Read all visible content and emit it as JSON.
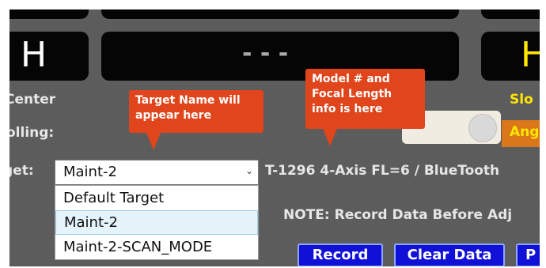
{
  "displays": {
    "left_value": "H",
    "center_value": "- - -",
    "right_value": "H"
  },
  "labels": {
    "center": "Center",
    "slope": "Slo",
    "rolling": "olling:",
    "target": "get:"
  },
  "callouts": {
    "target_name": "Target Name will appear here",
    "model_info": "Model # and Focal Length info is here"
  },
  "toggle": {
    "angle_label": "Ang"
  },
  "target_select": {
    "selected": "Maint-2",
    "options": [
      "Default Target",
      "Maint-2",
      "Maint-2-SCAN_MODE"
    ]
  },
  "model_info_text": "T-1296 4-Axis FL=6 / BlueTooth",
  "note": "NOTE: Record Data Before Adj",
  "buttons": {
    "record": "Record",
    "clear": "Clear Data",
    "partial": "P"
  },
  "colors": {
    "callout": "#e0451c",
    "display_text_yellow": "#ffe600",
    "button_blue": "#1010d6",
    "angle_orange": "#d9771a"
  }
}
